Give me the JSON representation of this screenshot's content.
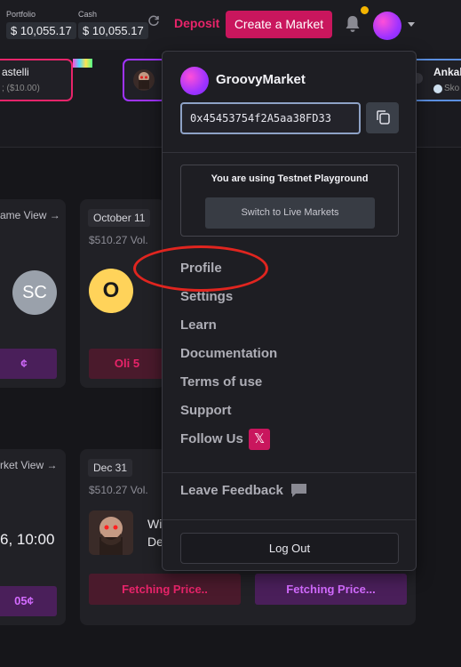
{
  "header": {
    "portfolio_label": "Portfolio",
    "portfolio_value": "$ 10,055.17",
    "cash_label": "Cash",
    "cash_value": "$ 10,055.17",
    "deposit_label": "Deposit",
    "create_market_label": "Create a Market"
  },
  "strip": {
    "item1_name": "astelli",
    "item1_sub": "; ($10.00)",
    "item3_name": "Ankala",
    "item3_sub": "Sko"
  },
  "cards": {
    "game_view_1": "ame View →",
    "date_1": "October 11",
    "vol_1": "$510.27 Vol.",
    "initials_sc": "SC",
    "initial_o": "O",
    "pill_left_1": "¢",
    "pill_right_1": "Oli 5",
    "market_view_2": "rket View →",
    "date_2": "Dec 31",
    "vol_2": "$510.27 Vol.",
    "time_text": "6, 10:00",
    "wi_text": "Wi",
    "de_text": "De",
    "price_left": "05¢",
    "fetching_1": "Fetching Price..",
    "fetching_2": "Fetching Price..."
  },
  "dropdown": {
    "username": "GroovyMarket",
    "address": "0x45453754f2A5aa38FD33",
    "testnet_notice": "You are using Testnet Playground",
    "switch_label": "Switch to Live Markets",
    "menu": [
      "Profile",
      "Settings",
      "Learn",
      "Documentation",
      "Terms of use",
      "Support",
      "Follow Us"
    ],
    "x_glyph": "𝕏",
    "feedback_label": "Leave Feedback",
    "logout_label": "Log Out"
  },
  "icons": {
    "refresh": "refresh-icon",
    "bell": "bell-icon",
    "copy": "copy-icon",
    "x": "x-logo-icon",
    "chat": "chat-bubble-icon"
  },
  "colors": {
    "accent": "#c9165d",
    "deposit": "#e8246a",
    "notification": "#f4b400",
    "highlight_annotation": "#e0251f"
  }
}
